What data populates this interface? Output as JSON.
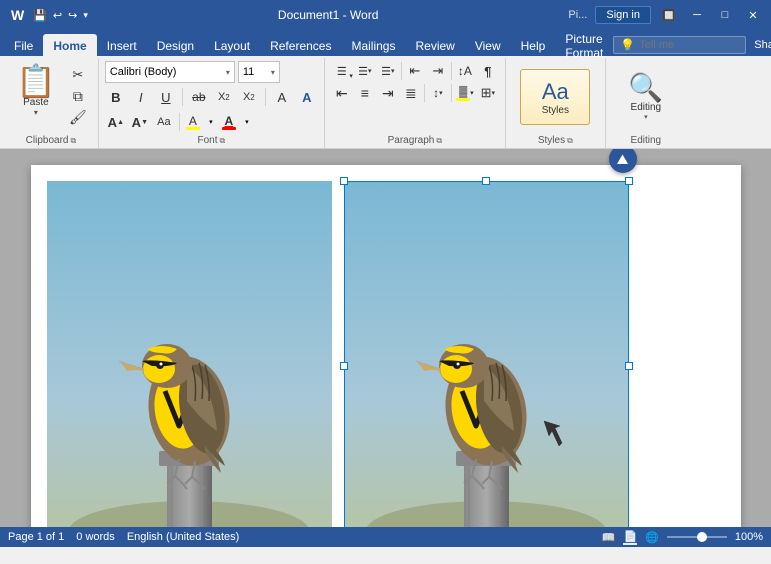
{
  "titleBar": {
    "title": "Document1 - Word",
    "appName": "Word",
    "docName": "Document1",
    "piLabel": "Pi...",
    "signInLabel": "Sign in",
    "qatButtons": [
      "save",
      "undo",
      "redo",
      "customize"
    ]
  },
  "menuTabs": {
    "tabs": [
      "File",
      "Home",
      "Insert",
      "Design",
      "Layout",
      "References",
      "Mailings",
      "Review",
      "View",
      "Help",
      "Picture Format"
    ],
    "activeTab": "Home",
    "lightbulbLabel": "💡",
    "tellMePlaceholder": "Tell me",
    "shareLabel": "Share"
  },
  "ribbon": {
    "groups": {
      "clipboard": {
        "label": "Clipboard",
        "pasteLabel": "Paste",
        "cutLabel": "Cut",
        "copyLabel": "Copy",
        "formatPainterLabel": "Format Painter"
      },
      "font": {
        "label": "Font",
        "fontName": "Calibri (Body)",
        "fontSize": "11",
        "bold": "B",
        "italic": "I",
        "underline": "U",
        "strikethrough": "ab",
        "subscript": "X₂",
        "superscript": "X²",
        "clearFormat": "A",
        "textEffects": "A",
        "fontColor": "A",
        "highlightColor": "A",
        "increaseFont": "A↑",
        "decreaseFont": "A↓",
        "changeCase": "Aa",
        "fontColorIndicator": "#FF0000",
        "highlightIndicator": "#FFFF00"
      },
      "paragraph": {
        "label": "Paragraph",
        "bullets": "≡",
        "numbering": "≡",
        "multiLevel": "≡",
        "decreaseIndent": "←",
        "increaseIndent": "→",
        "sort": "↕",
        "showHide": "¶",
        "alignLeft": "≡",
        "alignCenter": "≡",
        "alignRight": "≡",
        "justify": "≡",
        "lineSpacing": "≡",
        "shading": "▓",
        "borders": "⊞"
      },
      "styles": {
        "label": "Styles",
        "stylesLabel": "Styles"
      },
      "editing": {
        "label": "Editing",
        "editingLabel": "Editing"
      }
    }
  },
  "document": {
    "imageCount": 2,
    "selectedImageIndex": 1,
    "image1Alt": "Western Meadowlark bird on post",
    "image2Alt": "Western Meadowlark bird on post - selected"
  },
  "statusBar": {
    "pageInfo": "Page 1 of 1",
    "wordCount": "0 words",
    "language": "English (United States)",
    "views": [
      "read",
      "layout",
      "web"
    ],
    "activeView": "layout",
    "zoomLevel": "100%"
  },
  "icons": {
    "save": "💾",
    "undo": "↩",
    "redo": "↪",
    "cut": "✂",
    "copy": "⧉",
    "formatPainter": "🖌",
    "bold": "B",
    "italic": "I",
    "underline": "U",
    "bullets": "☰",
    "numbering": "☰",
    "alignLeft": "☰",
    "alignCenter": "☰",
    "alignRight": "☰",
    "justify": "☰",
    "imageFormat": "⛰"
  }
}
